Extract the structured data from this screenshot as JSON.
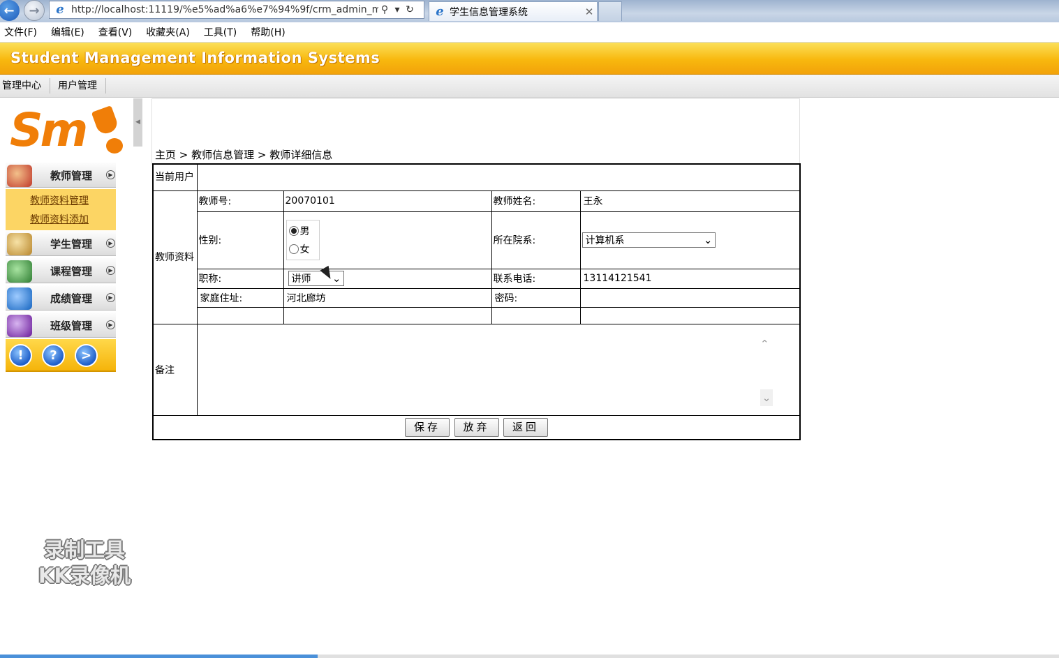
{
  "browser": {
    "url": "http://localhost:11119/%e5%ad%a6%e7%94%9f/crm_admin_m",
    "tab_title": "学生信息管理系统",
    "menu": [
      "文件(F)",
      "编辑(E)",
      "查看(V)",
      "收藏夹(A)",
      "工具(T)",
      "帮助(H)"
    ]
  },
  "header": {
    "title": "Student Management Information Systems"
  },
  "app_nav": [
    "管理中心",
    "用户管理"
  ],
  "logo": {
    "text": "Sm"
  },
  "sidebar": {
    "menus": [
      {
        "label": "教师管理",
        "icon": "teacher-icon",
        "color": "#c0392b"
      },
      {
        "label": "学生管理",
        "icon": "student-icon",
        "color": "#d9a441"
      },
      {
        "label": "课程管理",
        "icon": "course-icon",
        "color": "#2e7d32"
      },
      {
        "label": "成绩管理",
        "icon": "grade-icon",
        "color": "#1565c0"
      },
      {
        "label": "班级管理",
        "icon": "class-icon",
        "color": "#6a1b9a"
      }
    ],
    "teacher_submenu": [
      "教师资料管理",
      "教师资料添加"
    ],
    "bottom_buttons": [
      "!",
      "?",
      ">"
    ]
  },
  "breadcrumb": "主页 > 教师信息管理 > 教师详细信息",
  "form": {
    "current_user_label": "当前用户",
    "section_label": "教师资料",
    "teacher_no_label": "教师号:",
    "teacher_no": "20070101",
    "teacher_name_label": "教师姓名:",
    "teacher_name": "王永",
    "gender_label": "性别:",
    "gender_options": [
      "男",
      "女"
    ],
    "gender_selected": "男",
    "dept_label": "所在院系:",
    "dept_value": "计算机系",
    "title_label": "职称:",
    "title_value": "讲师",
    "phone_label": "联系电话:",
    "phone": "13114121541",
    "address_label": "家庭住址:",
    "address": "河北廊坊",
    "password_label": "密码:",
    "password": "",
    "remark_label": "备注",
    "remark": ""
  },
  "buttons": {
    "save": "保存",
    "discard": "放弃",
    "back": "返回"
  },
  "watermark": {
    "line1": "录制工具",
    "line2": "KK录像机"
  },
  "progress": {
    "percent": 30
  }
}
